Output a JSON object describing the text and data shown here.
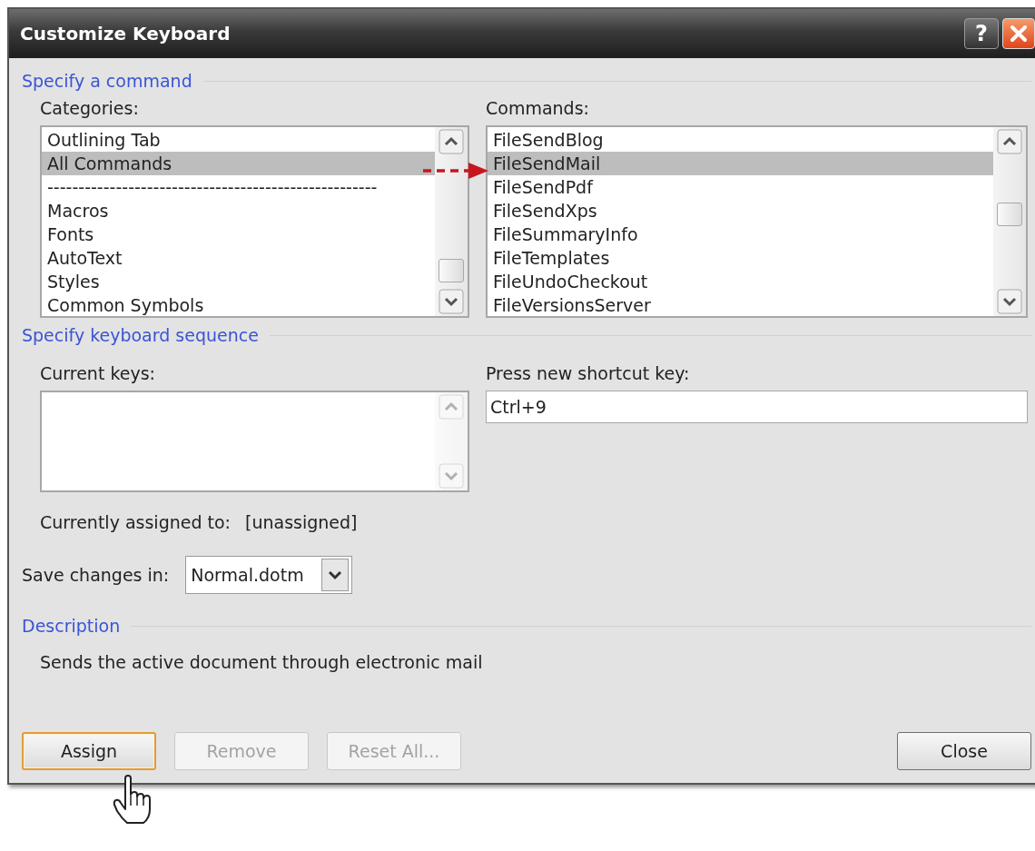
{
  "window": {
    "title": "Customize Keyboard",
    "help": "?"
  },
  "command_section": {
    "heading": "Specify a command",
    "categories": {
      "label": "Categories:",
      "items": [
        {
          "text": "Outlining Tab",
          "selected": false
        },
        {
          "text": "All Commands",
          "selected": true
        },
        {
          "text": "-----------------------------------------------------",
          "selected": false
        },
        {
          "text": "Macros",
          "selected": false
        },
        {
          "text": "Fonts",
          "selected": false
        },
        {
          "text": "AutoText",
          "selected": false
        },
        {
          "text": "Styles",
          "selected": false
        },
        {
          "text": "Common Symbols",
          "selected": false
        }
      ]
    },
    "commands": {
      "label": "Commands:",
      "items": [
        {
          "text": "FileSendBlog",
          "selected": false
        },
        {
          "text": "FileSendMail",
          "selected": true
        },
        {
          "text": "FileSendPdf",
          "selected": false
        },
        {
          "text": "FileSendXps",
          "selected": false
        },
        {
          "text": "FileSummaryInfo",
          "selected": false
        },
        {
          "text": "FileTemplates",
          "selected": false
        },
        {
          "text": "FileUndoCheckout",
          "selected": false
        },
        {
          "text": "FileVersionsServer",
          "selected": false
        }
      ]
    }
  },
  "keyboard_section": {
    "heading": "Specify keyboard sequence",
    "current_keys": {
      "label": "Current keys:",
      "disabled": true
    },
    "new_shortcut": {
      "label": "Press new shortcut key:",
      "value": "Ctrl+9"
    },
    "assigned_label": "Currently assigned to:",
    "assigned_value": "[unassigned]",
    "save_label": "Save changes in:",
    "save_value": "Normal.dotm"
  },
  "description_section": {
    "heading": "Description",
    "text": "Sends the active document through electronic mail"
  },
  "buttons": [
    {
      "label": "Assign",
      "disabled": false,
      "default": true
    },
    {
      "label": "Remove",
      "disabled": true,
      "default": false
    },
    {
      "label": "Reset All...",
      "disabled": true,
      "default": false
    }
  ],
  "close_button": {
    "label": "Close",
    "disabled": false,
    "default": false
  }
}
